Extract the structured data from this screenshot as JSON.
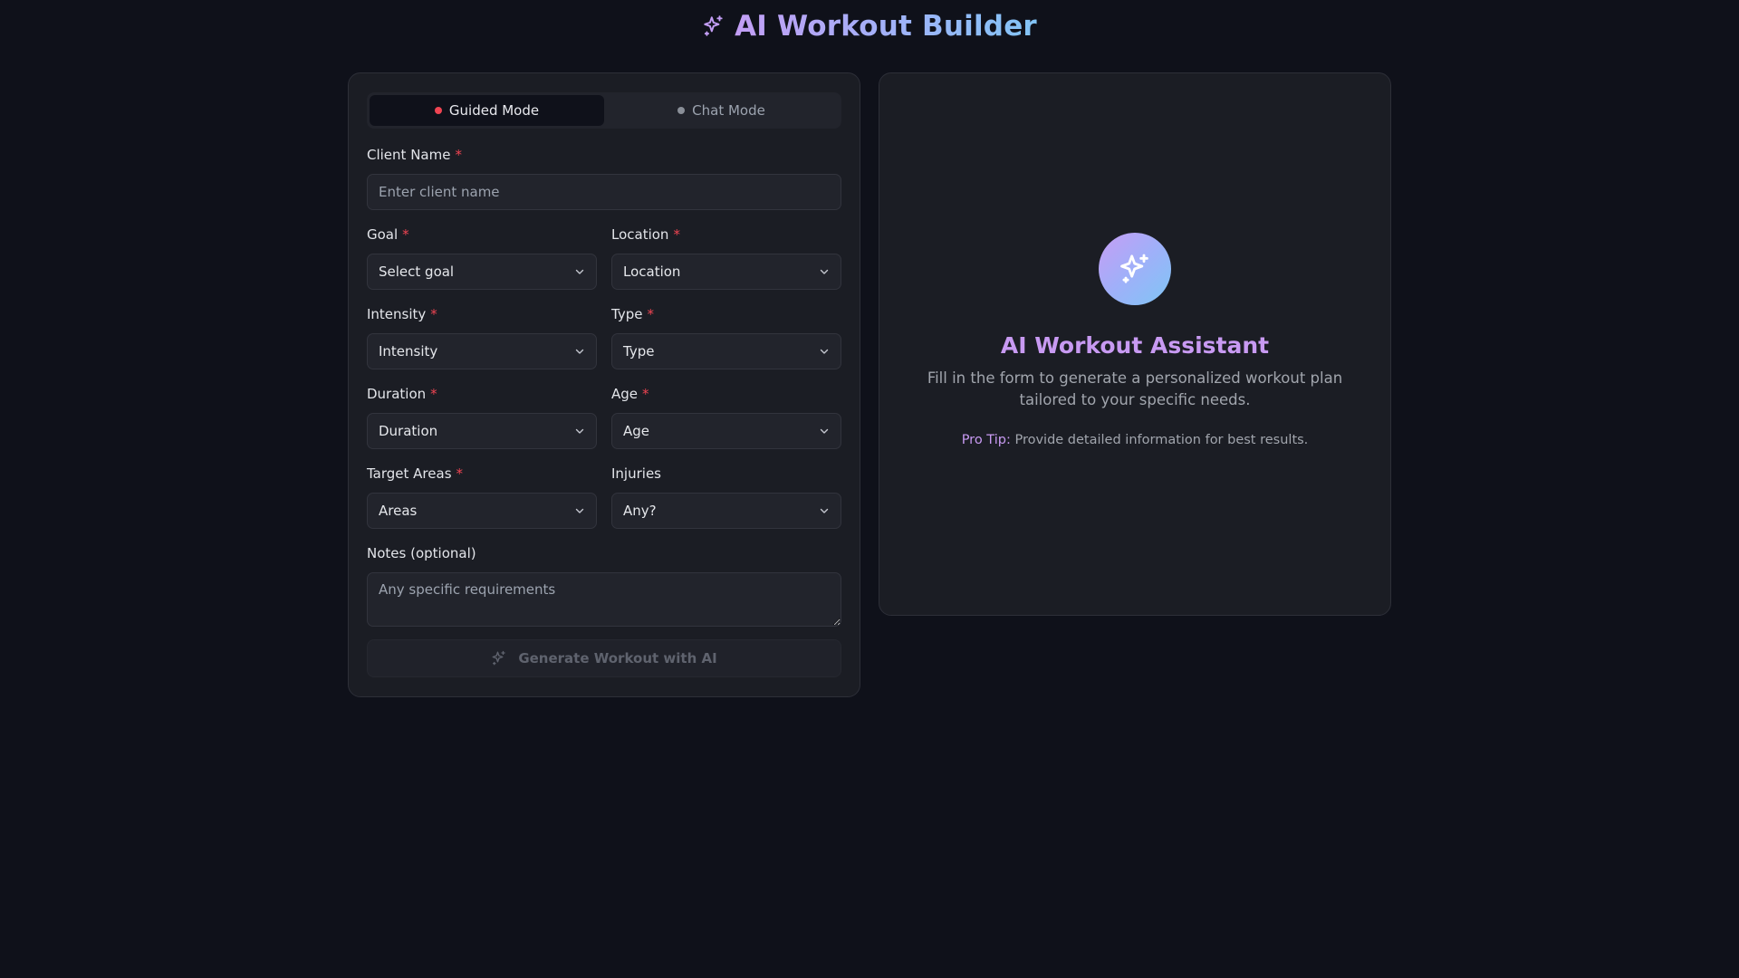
{
  "header": {
    "title": "AI Workout Builder",
    "icon": "sparkle-icon"
  },
  "modes": [
    {
      "label": "Guided Mode",
      "active": true
    },
    {
      "label": "Chat Mode",
      "active": false
    }
  ],
  "form": {
    "client_name": {
      "label": "Client Name",
      "required": "*",
      "placeholder": "Enter client name"
    },
    "goal": {
      "label": "Goal",
      "required": "*",
      "value": "Select goal"
    },
    "location": {
      "label": "Location",
      "required": "*",
      "value": "Location"
    },
    "intensity": {
      "label": "Intensity",
      "required": "*",
      "value": "Intensity"
    },
    "type": {
      "label": "Type",
      "required": "*",
      "value": "Type"
    },
    "duration": {
      "label": "Duration",
      "required": "*",
      "value": "Duration"
    },
    "age": {
      "label": "Age",
      "required": "*",
      "value": "Age"
    },
    "target_areas": {
      "label": "Target Areas",
      "required": "*",
      "value": "Areas"
    },
    "injuries": {
      "label": "Injuries",
      "value": "Any?"
    },
    "notes": {
      "label": "Notes (optional)",
      "placeholder": "Any specific requirements"
    },
    "generate_label": "Generate Workout with AI"
  },
  "assistant": {
    "title": "AI Workout Assistant",
    "description": "Fill in the form to generate a personalized workout plan tailored to your specific needs.",
    "tip_label": "Pro Tip:",
    "tip_text": "Provide detailed information for best results."
  },
  "colors": {
    "background": "#0f111a",
    "panel": "#1b1d24",
    "accent_purple": "#c89af2",
    "accent_blue": "#82c4f6",
    "required": "#ef4452"
  }
}
